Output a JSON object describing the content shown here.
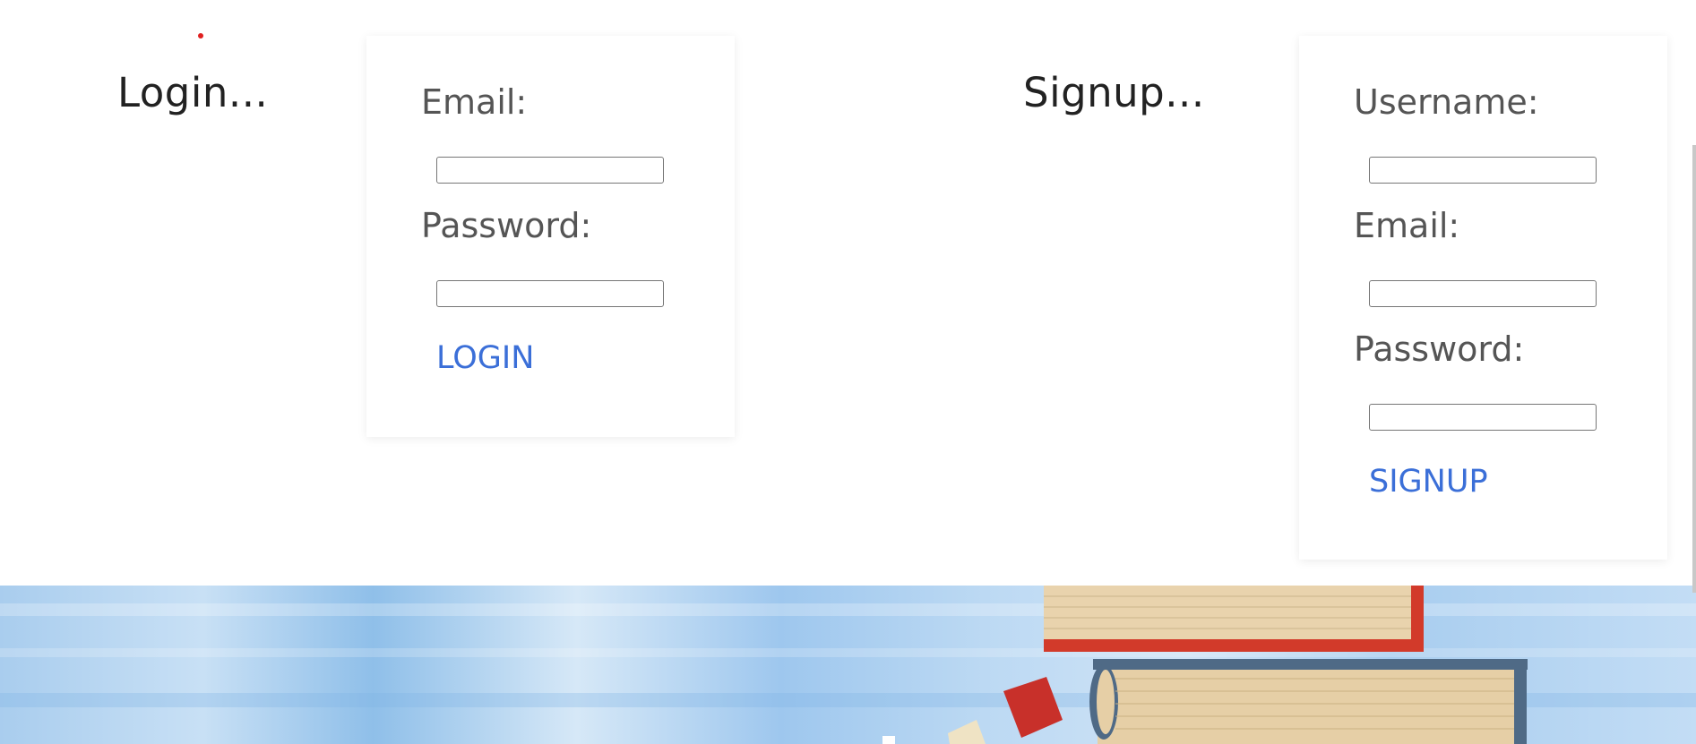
{
  "login": {
    "heading": "Login...",
    "email_label": "Email:",
    "password_label": "Password:",
    "button_label": "LOGIN"
  },
  "signup": {
    "heading": "Signup...",
    "username_label": "Username:",
    "email_label": "Email:",
    "password_label": "Password:",
    "button_label": "SIGNUP"
  },
  "colors": {
    "link": "#3b6fd8",
    "label": "#555555",
    "heading": "#222222",
    "dot": "#e02020"
  },
  "banner": {
    "icon": "books-stack-image"
  }
}
